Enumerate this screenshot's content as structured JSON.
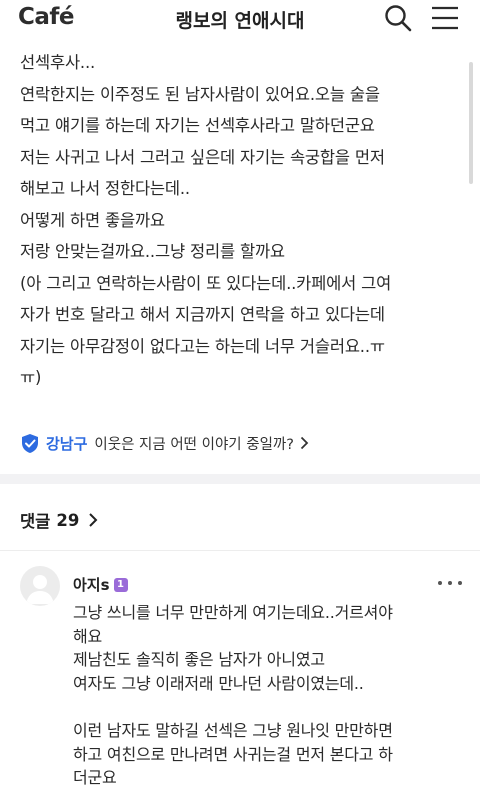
{
  "header": {
    "logo": "Café",
    "cafe_title": "랭보의 연애시대"
  },
  "post": {
    "lines": [
      "선섹후사...",
      "연락한지는 이주정도 된 남자사람이 있어요.오늘 술을",
      "먹고 얘기를 하는데 자기는 선섹후사라고 말하던군요",
      "저는 사귀고 나서 그러고 싶은데 자기는 속궁합을 먼저",
      "해보고 나서 정한다는데..",
      "어떻게 하면 좋을까요",
      "저랑 안맞는걸까요..그냥 정리를 할까요",
      "(아 그리고 연락하는사람이 또 있다는데..카페에서 그여",
      "자가 번호 달라고 해서 지금까지 연락을 하고 있다는데",
      "자기는 아무감정이 없다고는 하는데 너무 거슬러요..ㅠ",
      "ㅠ)"
    ]
  },
  "region": {
    "name": "강남구",
    "question": "이웃은 지금 어떤 이야기 중일까?"
  },
  "comments_section": {
    "label": "댓글",
    "count": "29"
  },
  "comment": {
    "author": "아지s",
    "level": "1",
    "lines_a": [
      "그냥 쓰니를 너무 만만하게 여기는데요..거르셔야",
      "해요",
      "제남친도 솔직히 좋은 남자가 아니였고",
      "여자도 그냥 이래저래 만나던 사람이였는데.."
    ],
    "lines_b": [
      "이런 남자도 말하길 선섹은 그냥 원나잇 만만하면",
      "하고 여친으로 만나려면 사귀는걸 먼저 본다고 하",
      "더군요"
    ]
  }
}
